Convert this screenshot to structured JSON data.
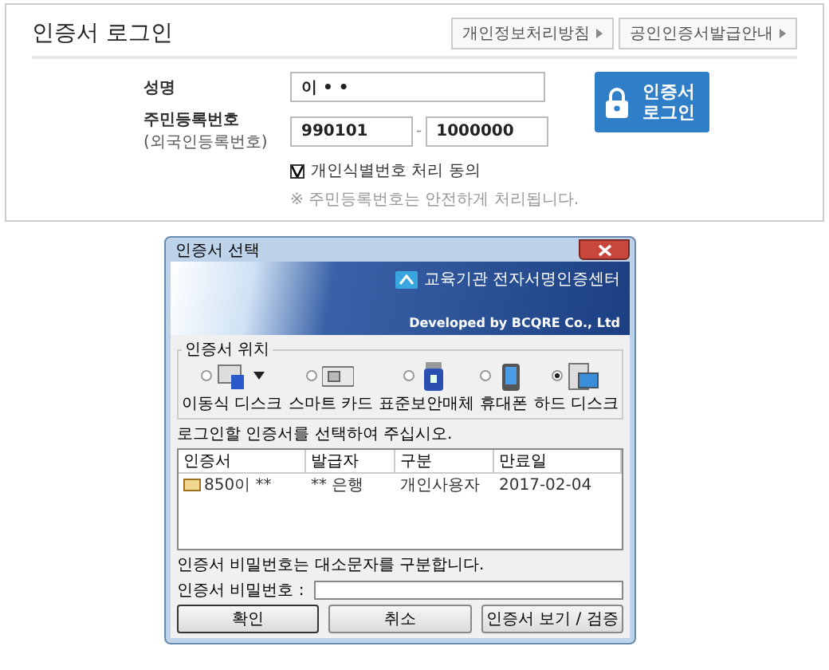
{
  "login": {
    "title": "인증서 로그인",
    "links": [
      {
        "label": "개인정보처리방침"
      },
      {
        "label": "공인인증서발급안내"
      }
    ],
    "name_label": "성명",
    "name_value": "이 • •",
    "id_label": "주민등록번호",
    "id_sublabel": "(외국인등록번호)",
    "id_first": "990101",
    "id_separator": "-",
    "id_second": "1000000",
    "login_button": [
      "인증서",
      "로그인"
    ],
    "consent": {
      "label": "개인식별번호 처리 동의",
      "checked": true
    },
    "note": "※ 주민등록번호는 안전하게 처리됩니다."
  },
  "dialog": {
    "title": "인증서 선택",
    "banner_org": "교육기관 전자서명인증센터",
    "banner_credit": "Developed by BCQRE Co., Ltd",
    "location_title": "인증서 위치",
    "locations": [
      {
        "kind": "usb",
        "label": "이동식 디스크",
        "selected": false
      },
      {
        "kind": "smartcard",
        "label": "스마트 카드",
        "selected": false
      },
      {
        "kind": "token",
        "label": "표준보안매체",
        "selected": false
      },
      {
        "kind": "phone",
        "label": "휴대폰",
        "selected": false
      },
      {
        "kind": "harddisk",
        "label": "하드 디스크",
        "selected": true
      }
    ],
    "prompt": "로그인할 인증서를 선택하여 주십시오.",
    "columns": [
      "인증서",
      "발급자",
      "구분",
      "만료일"
    ],
    "rows": [
      {
        "cells": [
          "850이 **",
          "** 은행",
          "개인사용자",
          "2017-02-04"
        ],
        "selected": false
      }
    ],
    "password_note": "인증서 비밀번호는 대소문자를 구분합니다.",
    "password_label": "인증서 비밀번호 :",
    "buttons": [
      "확인",
      "취소",
      "인증서 보기 / 검증"
    ]
  }
}
